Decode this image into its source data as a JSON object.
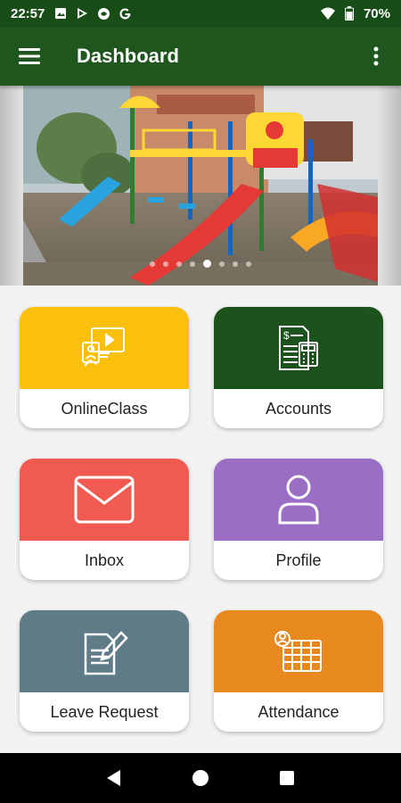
{
  "status_bar": {
    "time": "22:57",
    "left_icons": [
      "image-icon",
      "play-store-icon",
      "signal-app-icon",
      "google-icon"
    ],
    "right_icons": [
      "wifi-icon",
      "battery-icon"
    ],
    "battery": "70%"
  },
  "app_bar": {
    "title": "Dashboard",
    "menu_icon": "hamburger-menu-icon",
    "more_icon": "more-vertical-icon"
  },
  "carousel": {
    "dots_count": 8,
    "active_dot": 4
  },
  "tiles": [
    {
      "label": "OnlineClass",
      "color": "#fbc00d",
      "icon": "online-class-icon"
    },
    {
      "label": "Accounts",
      "color": "#1c521c",
      "icon": "accounts-invoice-icon"
    },
    {
      "label": "Inbox",
      "color": "#f05a50",
      "icon": "envelope-icon"
    },
    {
      "label": "Profile",
      "color": "#9b6ec5",
      "icon": "user-profile-icon"
    },
    {
      "label": "Leave Request",
      "color": "#5f7b88",
      "icon": "document-edit-icon"
    },
    {
      "label": "Attendance",
      "color": "#e8891f",
      "icon": "attendance-calendar-icon"
    }
  ],
  "nav_bar": {
    "back": "back-triangle-icon",
    "home": "home-circle-icon",
    "recents": "recents-square-icon"
  }
}
